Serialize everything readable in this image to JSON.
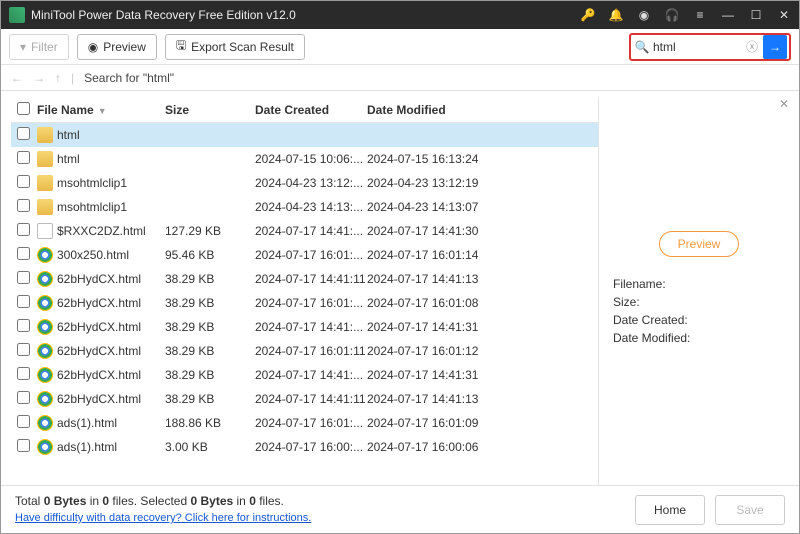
{
  "titlebar": {
    "title": "MiniTool Power Data Recovery Free Edition v12.0"
  },
  "toolbar": {
    "filter_label": "Filter",
    "preview_label": "Preview",
    "export_label": "Export Scan Result"
  },
  "search": {
    "value": "html",
    "placeholder": ""
  },
  "crumbs": {
    "label": "Search for  \"html\""
  },
  "columns": {
    "cb": "",
    "name": "File Name",
    "size": "Size",
    "created": "Date Created",
    "modified": "Date Modified"
  },
  "rows": [
    {
      "sel": true,
      "icon": "folder",
      "name": "html",
      "size": "",
      "created": "",
      "modified": ""
    },
    {
      "icon": "folder",
      "name": "html",
      "size": "",
      "created": "2024-07-15 10:06:...",
      "modified": "2024-07-15 16:13:24"
    },
    {
      "icon": "folder",
      "name": "msohtmlclip1",
      "size": "",
      "created": "2024-04-23 13:12:...",
      "modified": "2024-04-23 13:12:19"
    },
    {
      "icon": "folder",
      "name": "msohtmlclip1",
      "size": "",
      "created": "2024-04-23 14:13:...",
      "modified": "2024-04-23 14:13:07"
    },
    {
      "icon": "page",
      "name": "$RXXC2DZ.html",
      "size": "127.29 KB",
      "created": "2024-07-17 14:41:...",
      "modified": "2024-07-17 14:41:30"
    },
    {
      "icon": "chrome",
      "name": "300x250.html",
      "size": "95.46 KB",
      "created": "2024-07-17 16:01:...",
      "modified": "2024-07-17 16:01:14"
    },
    {
      "icon": "chrome",
      "name": "62bHydCX.html",
      "size": "38.29 KB",
      "created": "2024-07-17 14:41:11",
      "modified": "2024-07-17 14:41:13"
    },
    {
      "icon": "chrome",
      "name": "62bHydCX.html",
      "size": "38.29 KB",
      "created": "2024-07-17 16:01:...",
      "modified": "2024-07-17 16:01:08"
    },
    {
      "icon": "chrome",
      "name": "62bHydCX.html",
      "size": "38.29 KB",
      "created": "2024-07-17 14:41:...",
      "modified": "2024-07-17 14:41:31"
    },
    {
      "icon": "chrome",
      "name": "62bHydCX.html",
      "size": "38.29 KB",
      "created": "2024-07-17 16:01:11",
      "modified": "2024-07-17 16:01:12"
    },
    {
      "icon": "chrome",
      "name": "62bHydCX.html",
      "size": "38.29 KB",
      "created": "2024-07-17 14:41:...",
      "modified": "2024-07-17 14:41:31"
    },
    {
      "icon": "chrome",
      "name": "62bHydCX.html",
      "size": "38.29 KB",
      "created": "2024-07-17 14:41:11",
      "modified": "2024-07-17 14:41:13"
    },
    {
      "icon": "chrome",
      "name": "ads(1).html",
      "size": "188.86 KB",
      "created": "2024-07-17 16:01:...",
      "modified": "2024-07-17 16:01:09"
    },
    {
      "icon": "chrome",
      "name": "ads(1).html",
      "size": "3.00 KB",
      "created": "2024-07-17 16:00:...",
      "modified": "2024-07-17 16:00:06"
    }
  ],
  "side": {
    "preview_btn": "Preview",
    "filename_lbl": "Filename:",
    "size_lbl": "Size:",
    "created_lbl": "Date Created:",
    "modified_lbl": "Date Modified:"
  },
  "footer": {
    "line1_a": "Total ",
    "line1_b": "0 Bytes",
    "line1_c": " in ",
    "line1_d": "0",
    "line1_e": " files.   Selected ",
    "line1_f": "0 Bytes",
    "line1_g": " in ",
    "line1_h": "0",
    "line1_i": " files.",
    "help": "Have difficulty with data recovery? Click here for instructions.",
    "home": "Home",
    "save": "Save"
  }
}
